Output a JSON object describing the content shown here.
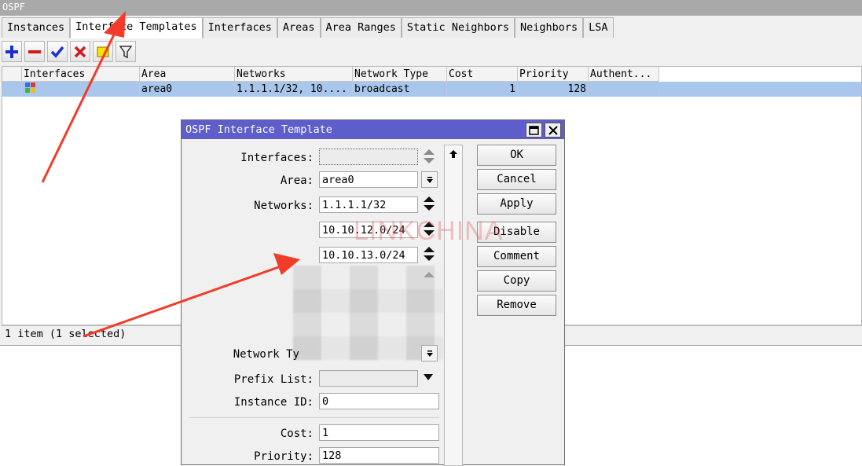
{
  "window": {
    "title": "OSPF"
  },
  "tabs": [
    "Instances",
    "Interface Templates",
    "Interfaces",
    "Areas",
    "Area Ranges",
    "Static Neighbors",
    "Neighbors",
    "LSA"
  ],
  "toolbar_icons": [
    "plus-icon",
    "minus-icon",
    "check-icon",
    "cross-icon",
    "comment-icon",
    "filter-icon"
  ],
  "table": {
    "headers": [
      "Interfaces",
      "Area",
      "Networks",
      "Network Type",
      "Cost",
      "Priority",
      "Authent..."
    ],
    "rows": [
      {
        "interfaces": "",
        "area": "area0",
        "networks": "1.1.1.1/32, 10....",
        "network_type": "broadcast",
        "cost": "1",
        "priority": "128",
        "auth": ""
      }
    ]
  },
  "status": "1 item (1 selected)",
  "dialog": {
    "title": "OSPF Interface Template",
    "labels": {
      "interfaces": "Interfaces:",
      "area": "Area:",
      "networks": "Networks:",
      "network_type": "Network Ty",
      "prefix_list": "Prefix List:",
      "instance_id": "Instance ID:",
      "cost": "Cost:",
      "priority": "Priority:"
    },
    "values": {
      "interfaces": "",
      "area": "area0",
      "networks": [
        "1.1.1.1/32",
        "10.10.12.0/24",
        "10.10.13.0/24"
      ],
      "prefix_list": "",
      "instance_id": "0",
      "cost": "1",
      "priority": "128"
    },
    "buttons": [
      "OK",
      "Cancel",
      "Apply",
      "Disable",
      "Comment",
      "Copy",
      "Remove"
    ]
  },
  "watermark": "LINKCHINA",
  "colors": {
    "selection": "#a9c7ec",
    "dialog_title": "#5d5dcc",
    "annotation_arrow": "#f23b28"
  }
}
